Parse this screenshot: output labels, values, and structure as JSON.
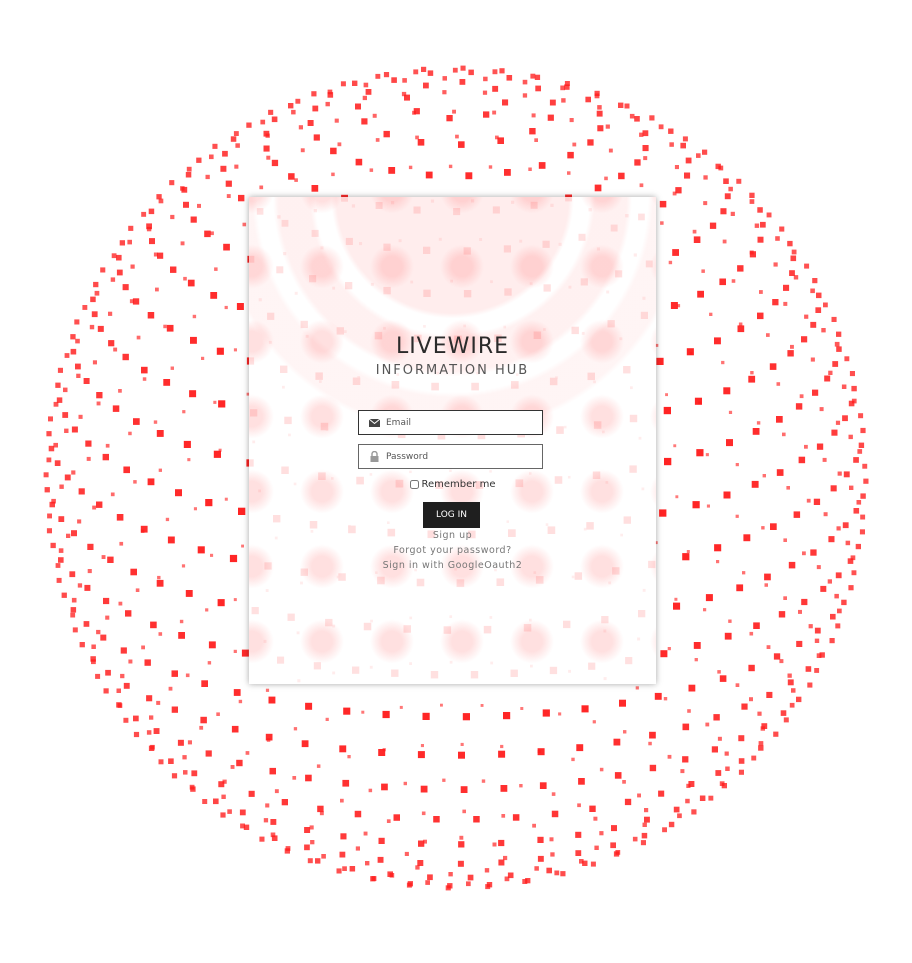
{
  "brand": {
    "title": "LIVEWIRE",
    "subtitle": "INFORMATION HUB"
  },
  "login_form": {
    "email_placeholder": "Email",
    "password_placeholder": "Password",
    "remember_label": "Remember me",
    "remember_checked": false,
    "submit_label": "LOG IN"
  },
  "links": {
    "signup": "Sign up",
    "forgot_password": "Forgot your password?",
    "google_signin": "Sign in with GoogleOauth2"
  },
  "icons": {
    "email": "envelope-icon",
    "password": "lock-icon"
  },
  "colors": {
    "background_dots": "#ff1a1a",
    "button_bg": "#1f1f1f",
    "button_text": "#ffffff",
    "title_text": "#2b2b2b",
    "link_text": "#777777"
  }
}
